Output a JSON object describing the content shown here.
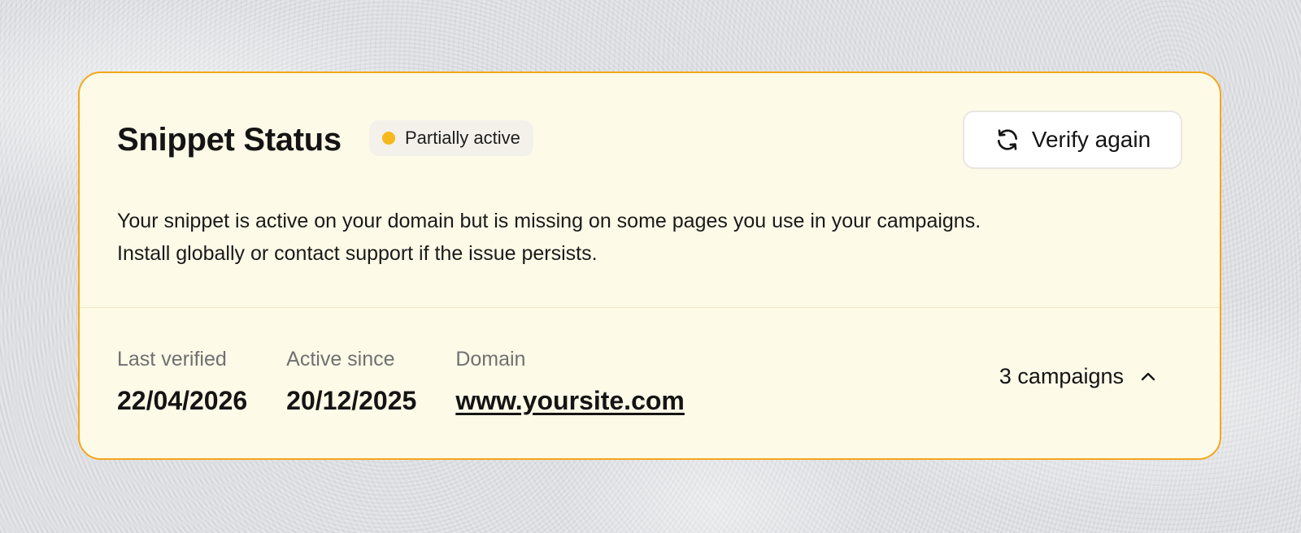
{
  "card": {
    "title": "Snippet Status",
    "status_badge": {
      "label": "Partially active",
      "dot_color": "#f6b81c"
    },
    "verify_button": {
      "label": "Verify again",
      "icon": "refresh-icon"
    },
    "description": {
      "line1": "Your snippet is active on your domain but is missing on some pages you use in your campaigns.",
      "line2": "Install globally or contact support if the issue persists."
    },
    "meta": {
      "last_verified": {
        "label": "Last verified",
        "value": "22/04/2026"
      },
      "active_since": {
        "label": "Active since",
        "value": "20/12/2025"
      },
      "domain": {
        "label": "Domain",
        "value": "www.yoursite.com"
      }
    },
    "campaigns_toggle": {
      "label": "3 campaigns",
      "icon": "chevron-up-icon"
    }
  },
  "colors": {
    "card_background": "#fefae8",
    "card_border": "#f1a81c",
    "accent_dot": "#f6b81c"
  }
}
